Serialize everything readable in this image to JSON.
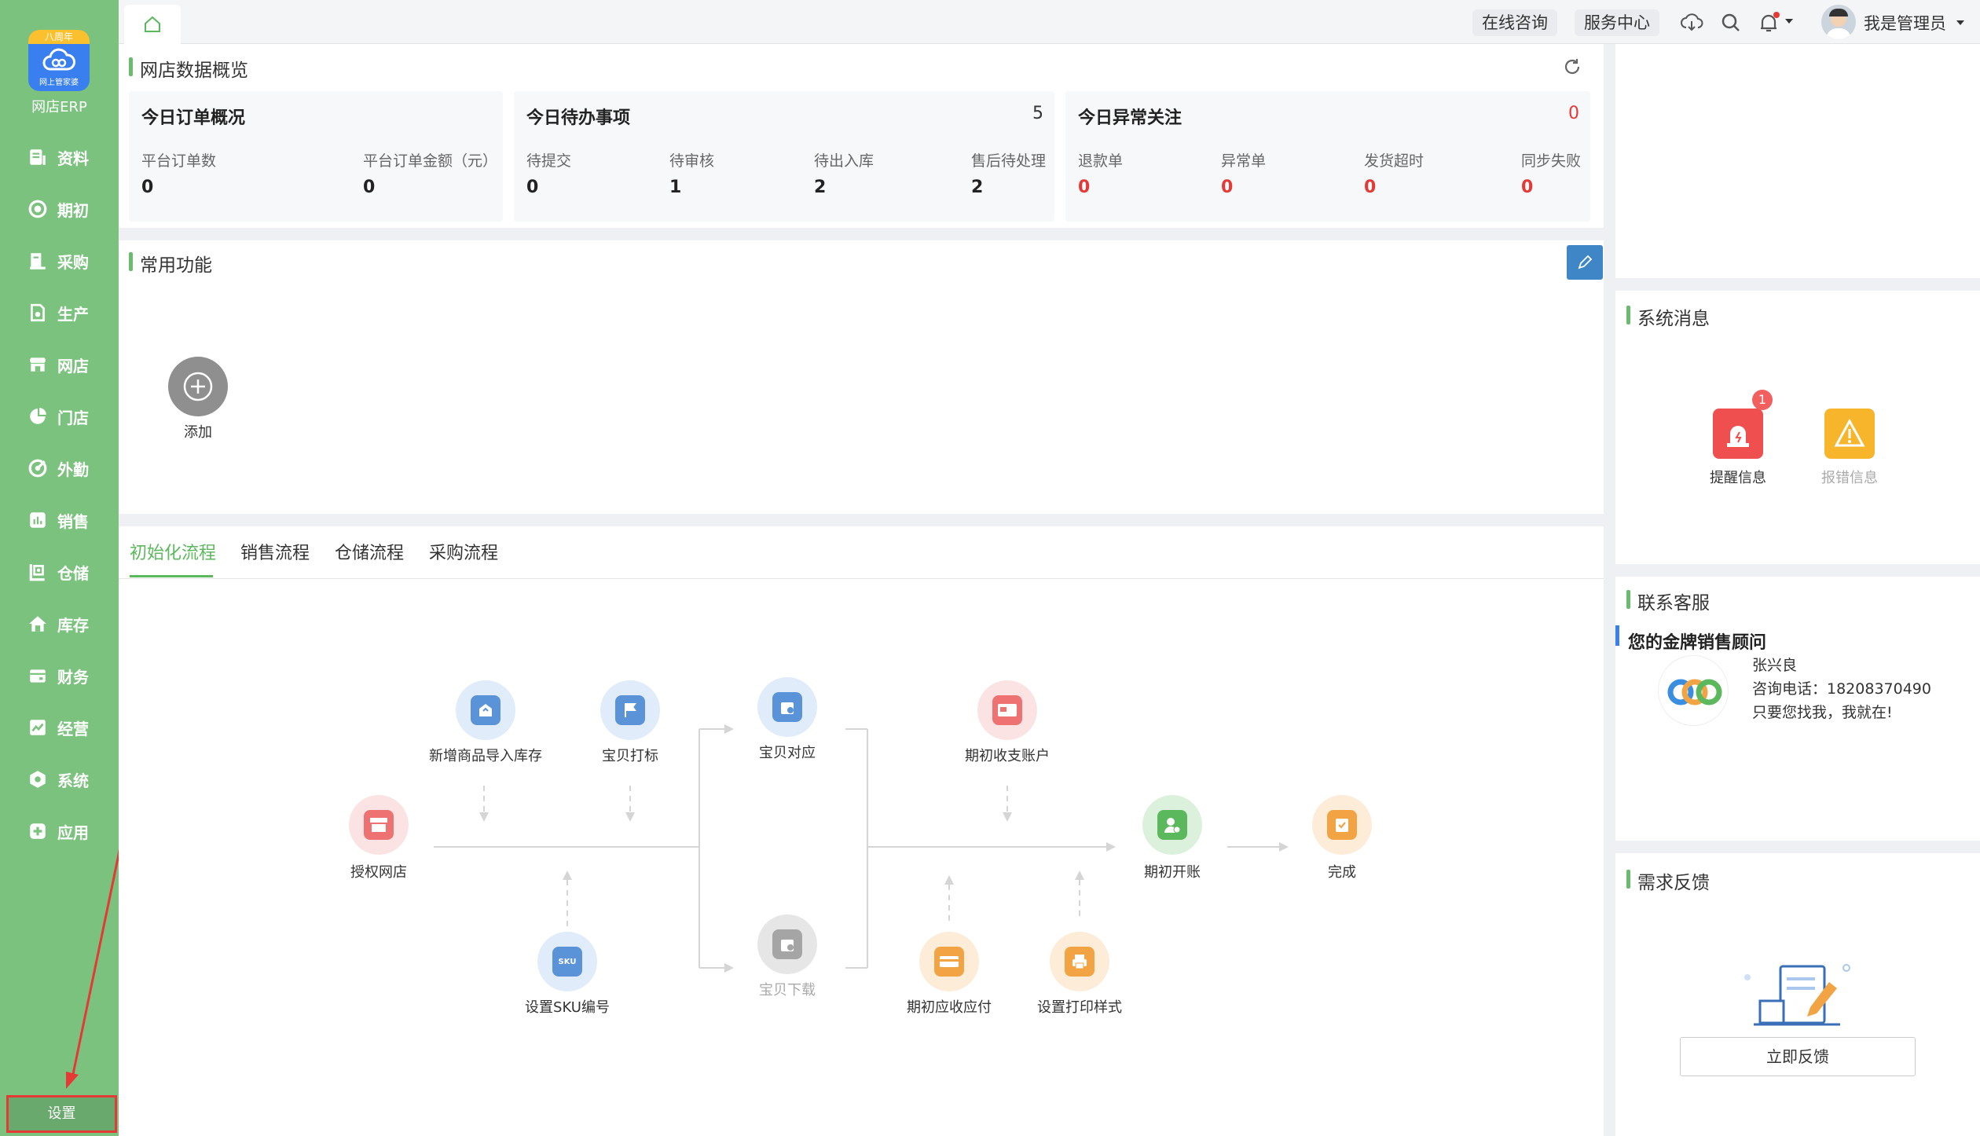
{
  "app": {
    "logo_ribbon": "八周年",
    "logo_sub": "网上管家婆",
    "name": "网店ERP"
  },
  "nav": [
    {
      "label": "资料",
      "icon": "document-icon"
    },
    {
      "label": "期初",
      "icon": "target-icon"
    },
    {
      "label": "采购",
      "icon": "cart-icon"
    },
    {
      "label": "生产",
      "icon": "factory-icon"
    },
    {
      "label": "网店",
      "icon": "store-icon"
    },
    {
      "label": "门店",
      "icon": "pie-icon"
    },
    {
      "label": "外勤",
      "icon": "compass-icon"
    },
    {
      "label": "销售",
      "icon": "bar-chart-icon"
    },
    {
      "label": "仓储",
      "icon": "warehouse-icon"
    },
    {
      "label": "库存",
      "icon": "house-icon"
    },
    {
      "label": "财务",
      "icon": "wallet-icon"
    },
    {
      "label": "经营",
      "icon": "trend-icon"
    },
    {
      "label": "系统",
      "icon": "hexagon-gear-icon"
    },
    {
      "label": "应用",
      "icon": "plus-square-icon"
    }
  ],
  "settings_label": "设置",
  "topbar": {
    "consult": "在线咨询",
    "service": "服务中心",
    "user": "我是管理员"
  },
  "overview": {
    "title": "网店数据概览",
    "orders": {
      "title": "今日订单概况",
      "labels": [
        "平台订单数",
        "平台订单金额（元）"
      ],
      "values": [
        "0",
        "0"
      ]
    },
    "todo": {
      "title": "今日待办事项",
      "count": "5",
      "labels": [
        "待提交",
        "待审核",
        "待出入库",
        "售后待处理"
      ],
      "values": [
        "0",
        "1",
        "2",
        "2"
      ]
    },
    "abnormal": {
      "title": "今日异常关注",
      "count": "0",
      "labels": [
        "退款单",
        "异常单",
        "发货超时",
        "同步失败"
      ],
      "values": [
        "0",
        "0",
        "0",
        "0"
      ]
    }
  },
  "common": {
    "title": "常用功能",
    "add_label": "添加"
  },
  "flow_tabs": [
    "初始化流程",
    "销售流程",
    "仓储流程",
    "采购流程"
  ],
  "flow_nodes": {
    "auth_shop": "授权网店",
    "new_goods": "新增商品导入库存",
    "baby_tag": "宝贝打标",
    "sku": "设置SKU编号",
    "baby_match": "宝贝对应",
    "baby_download": "宝贝下载",
    "init_account": "期初收支账户",
    "init_receivable": "期初应收应付",
    "print_style": "设置打印样式",
    "open_account": "期初开账",
    "done": "完成"
  },
  "system_msg": {
    "title": "系统消息",
    "reminder": "提醒信息",
    "reminder_badge": "1",
    "error": "报错信息"
  },
  "contact": {
    "title": "联系客服",
    "subtitle": "您的金牌销售顾问",
    "name": "张兴良",
    "phone": "咨询电话：18208370490",
    "slogan": "只要您找我，我就在!"
  },
  "feedback": {
    "title": "需求反馈",
    "button": "立即反馈"
  },
  "colors": {
    "sidebar": "#7cc27f",
    "accent": "#5cb85c",
    "alert": "#e53935"
  }
}
